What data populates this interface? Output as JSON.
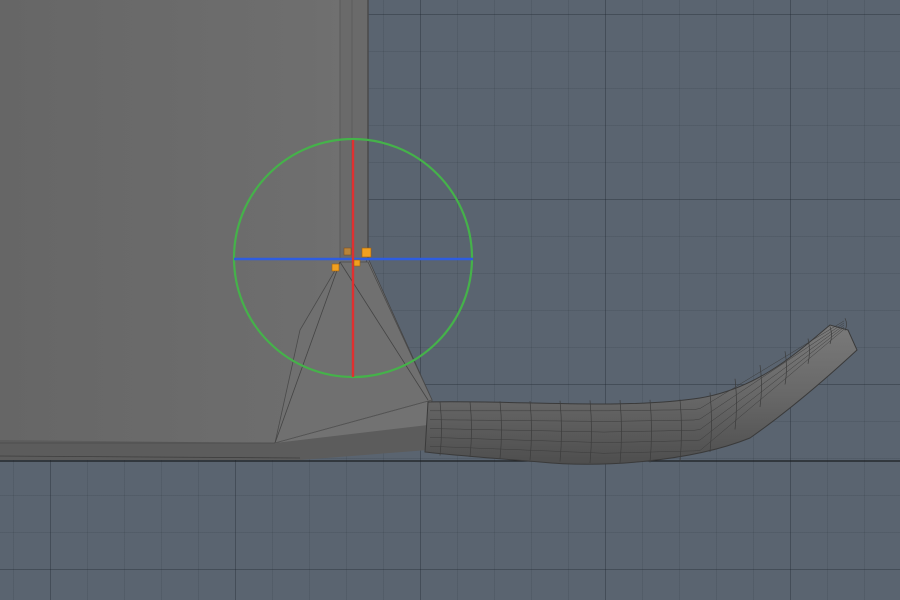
{
  "viewport": {
    "background_color": "#5a6470",
    "grid_color": "#3e4752",
    "ground_line_color": "#1a1d20"
  },
  "mesh": {
    "body_color": "#6e6e6e",
    "body_edge_color": "#4a4a4a",
    "wire_color": "#3c3c3c",
    "tail_color": "#6a6a6a"
  },
  "gizmo": {
    "type": "rotate",
    "ring_color": "#45b24a",
    "x_axis_color": "#2e5de0",
    "y_axis_color": "#e03030"
  },
  "selection": {
    "handle_color": "#f0a020",
    "vertex_count": 4
  }
}
